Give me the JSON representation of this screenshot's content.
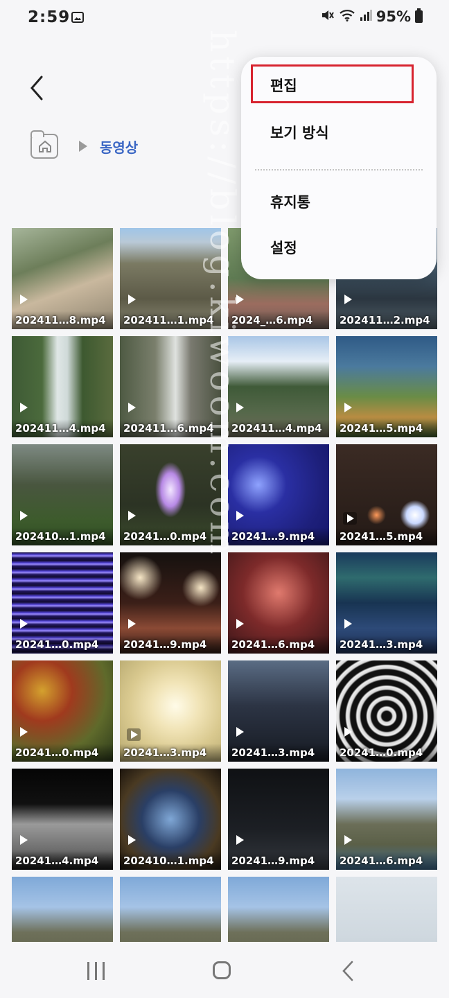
{
  "status_bar": {
    "time": "2:59",
    "battery": "95%"
  },
  "breadcrumb": {
    "current": "동영상"
  },
  "menu": {
    "items": [
      "편집",
      "보기 방식",
      "휴지통",
      "설정"
    ],
    "highlight_color": "#d7232f"
  },
  "watermark": "https://blog.kiwoom.com",
  "videos": [
    "202411…8.mp4",
    "202411…1.mp4",
    "2024_…6.mp4",
    "202411…2.mp4",
    "202411…4.mp4",
    "202411…6.mp4",
    "202411…4.mp4",
    "20241…5.mp4",
    "202410…1.mp4",
    "20241…0.mp4",
    "20241…9.mp4",
    "20241…5.mp4",
    "20241…0.mp4",
    "20241…9.mp4",
    "20241…6.mp4",
    "20241…3.mp4",
    "20241…0.mp4",
    "20241…3.mp4",
    "20241…3.mp4",
    "20241…0.mp4",
    "20241…4.mp4",
    "202410…1.mp4",
    "20241…9.mp4",
    "20241…6.mp4",
    "",
    "",
    "",
    ""
  ]
}
